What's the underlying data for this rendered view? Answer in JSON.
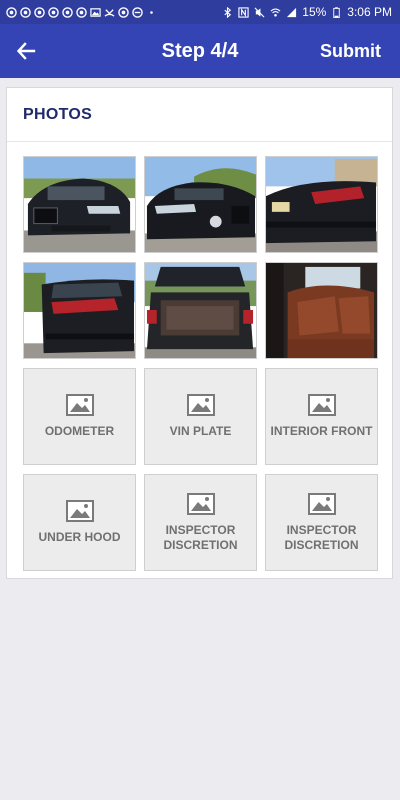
{
  "status_bar": {
    "battery_percent": "15%",
    "time": "3:06 PM",
    "bg_color": "#2f3d9e"
  },
  "app_bar": {
    "title": "Step 4/4",
    "submit_label": "Submit",
    "back_icon": "arrow-left-icon",
    "bg_color": "#3444b4"
  },
  "photos_section": {
    "title": "PHOTOS",
    "captured_photos": [
      {
        "subject": "car-front-photo"
      },
      {
        "subject": "car-front-left-photo"
      },
      {
        "subject": "car-rear-right-photo"
      },
      {
        "subject": "car-rear-left-photo"
      },
      {
        "subject": "open-trunk-photo"
      },
      {
        "subject": "rear-seats-photo"
      }
    ],
    "empty_slots": [
      {
        "label": "ODOMETER",
        "icon": "image-placeholder-icon"
      },
      {
        "label": "VIN PLATE",
        "icon": "image-placeholder-icon"
      },
      {
        "label": "INTERIOR FRONT",
        "icon": "image-placeholder-icon"
      },
      {
        "label": "UNDER HOOD",
        "icon": "image-placeholder-icon"
      },
      {
        "label": "INSPECTOR DISCRETION",
        "icon": "image-placeholder-icon"
      },
      {
        "label": "INSPECTOR DISCRETION",
        "icon": "image-placeholder-icon"
      }
    ]
  }
}
